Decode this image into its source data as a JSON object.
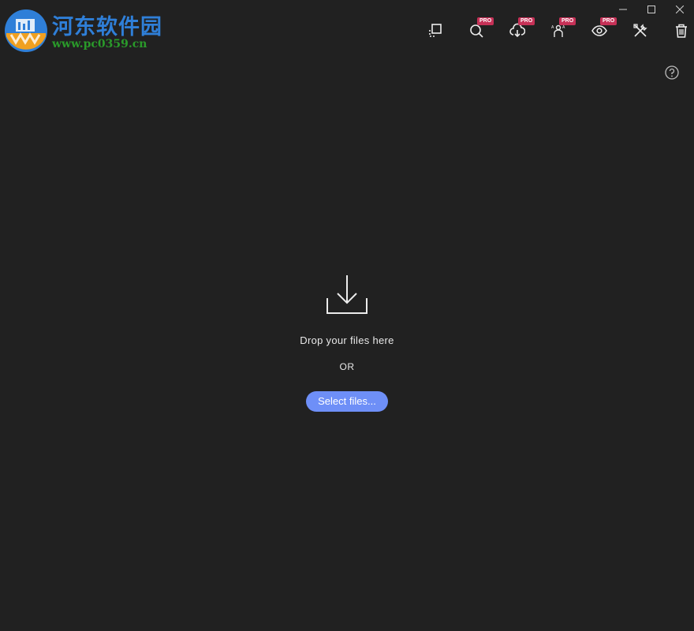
{
  "watermark": {
    "title": "河东软件园",
    "url": "www.pc0359.cn"
  },
  "toolbar": {
    "tools": [
      {
        "icon": "resize-icon",
        "pro": ""
      },
      {
        "icon": "search-icon",
        "pro": "PRO"
      },
      {
        "icon": "cloud-download-icon",
        "pro": "PRO"
      },
      {
        "icon": "translate-icon",
        "pro": "PRO"
      },
      {
        "icon": "eye-icon",
        "pro": "PRO"
      },
      {
        "icon": "tools-icon",
        "pro": ""
      },
      {
        "icon": "trash-icon",
        "pro": ""
      }
    ]
  },
  "window_controls": {
    "minimize": "─",
    "maximize": "☐",
    "close": "✕"
  },
  "help": {
    "icon": "help-icon"
  },
  "dropzone": {
    "drop_text": "Drop your files here",
    "or_text": "OR",
    "select_label": "Select files..."
  },
  "colors": {
    "background": "#212121",
    "accent": "#6e8ff7",
    "pro_badge": "#c63157",
    "icon": "#ececec"
  }
}
